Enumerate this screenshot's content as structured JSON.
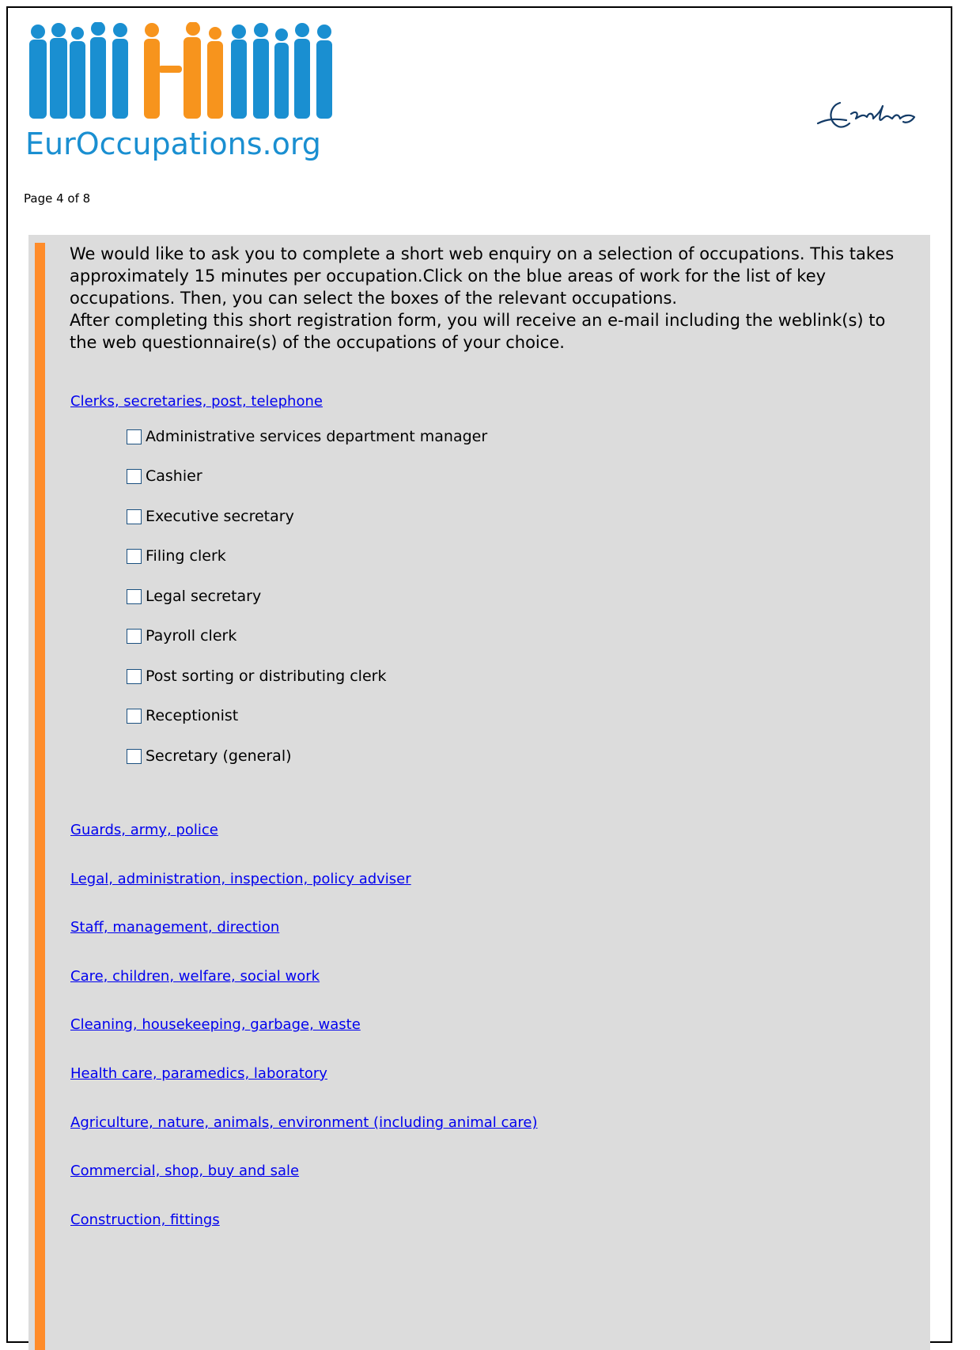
{
  "header": {
    "logo_text_prefix": "Eur",
    "logo_text_suffix": "Occupations.org",
    "logo_colors": {
      "blue": "#1a8fd1",
      "orange": "#f7941d"
    },
    "signature": "Erasmus",
    "page_indicator": "Page 4 of 8"
  },
  "intro": {
    "paragraph1": "We would like to ask you to complete a short web enquiry on a selection of occupations. This takes approximately 15 minutes per occupation.Click on the blue areas of work for the list of key occupations. Then, you can select the boxes of the relevant occupations.",
    "paragraph2": "After completing this short registration form, you will receive an e-mail including the weblink(s) to the web questionnaire(s) of the occupations of your choice."
  },
  "expanded_category": {
    "label": "Clerks, secretaries, post, telephone",
    "occupations": [
      {
        "label": "Administrative services department manager",
        "checked": false
      },
      {
        "label": "Cashier",
        "checked": false
      },
      {
        "label": "Executive secretary",
        "checked": false
      },
      {
        "label": "Filing clerk",
        "checked": false
      },
      {
        "label": "Legal secretary",
        "checked": false
      },
      {
        "label": "Payroll clerk",
        "checked": false
      },
      {
        "label": "Post sorting or distributing clerk",
        "checked": false
      },
      {
        "label": "Receptionist",
        "checked": false
      },
      {
        "label": "Secretary (general)",
        "checked": false
      }
    ]
  },
  "categories": [
    "Guards, army, police",
    "Legal, administration, inspection, policy adviser",
    "Staff, management, direction",
    "Care, children, welfare, social work",
    "Cleaning, housekeeping, garbage, waste",
    "Health care, paramedics, laboratory",
    "Agriculture, nature, animals, environment (including animal care)",
    "Commercial, shop, buy and sale",
    "Construction, fittings"
  ],
  "colors": {
    "panel_bg": "#dcdcdc",
    "accent_bar": "#ff8c2a",
    "link": "#0000ee"
  }
}
